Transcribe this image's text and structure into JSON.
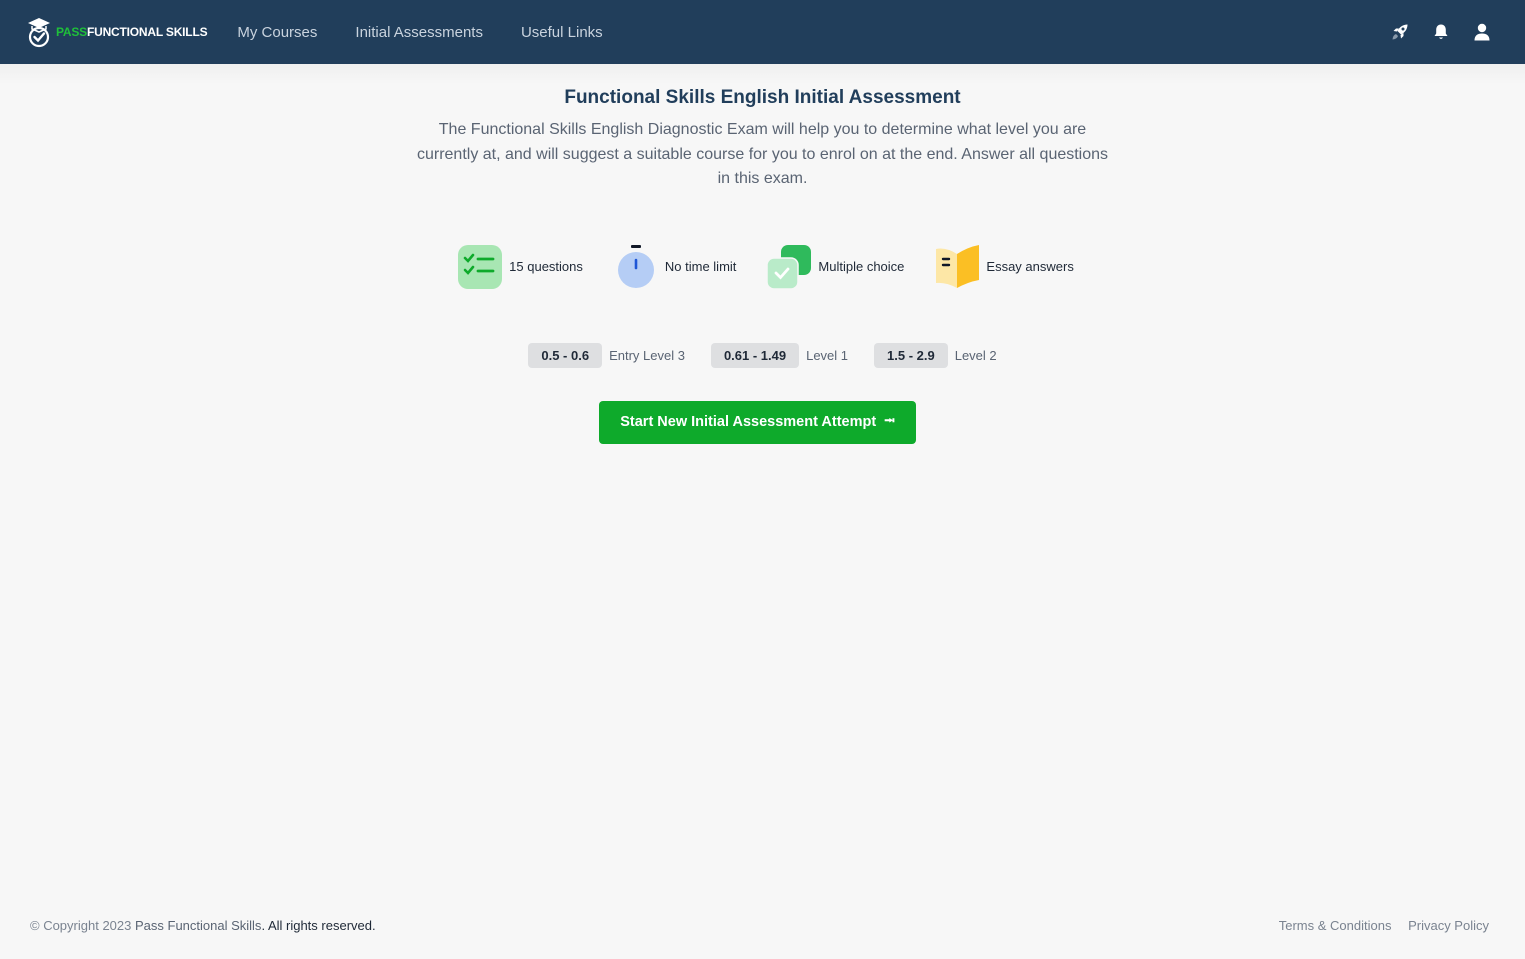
{
  "navbar": {
    "brand_pass": "PASS",
    "brand_rest": "FUNCTIONAL SKILLS",
    "links": [
      "My Courses",
      "Initial Assessments",
      "Useful Links"
    ],
    "icons": [
      "rocket-icon",
      "bell-icon",
      "user-icon"
    ],
    "bg_color": "#213e5b"
  },
  "main": {
    "title": "Functional Skills English Initial Assessment",
    "description": "The Functional Skills English Diagnostic Exam will help you to determine what level you are currently at, and will suggest a suitable course for you to enrol on at the end. Answer all questions in this exam.",
    "features": [
      {
        "icon": "checklist-icon",
        "label": "15 questions"
      },
      {
        "icon": "stopwatch-icon",
        "label": "No time limit"
      },
      {
        "icon": "multiple-choice-icon",
        "label": "Multiple choice"
      },
      {
        "icon": "open-book-icon",
        "label": "Essay answers"
      }
    ],
    "levels": [
      {
        "range": "0.5 - 0.6",
        "name": "Entry Level 3"
      },
      {
        "range": "0.61 - 1.49",
        "name": "Level 1"
      },
      {
        "range": "1.5 - 2.9",
        "name": "Level 2"
      }
    ],
    "start_button": "Start New Initial Assessment Attempt",
    "start_button_icon": "⭲",
    "accent_color": "#0eaa2b"
  },
  "footer": {
    "copyright_prefix": "© Copyright 2023 ",
    "copyright_brand": "Pass Functional Skills",
    "copyright_suffix": ". All rights reserved.",
    "links": [
      "Terms & Conditions",
      "Privacy Policy"
    ]
  }
}
